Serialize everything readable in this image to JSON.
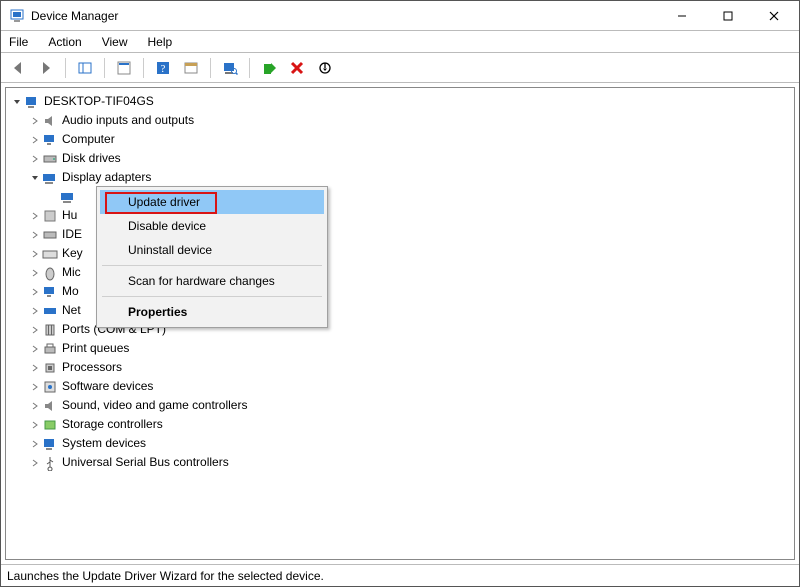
{
  "window": {
    "title": "Device Manager"
  },
  "menu": {
    "file": "File",
    "action": "Action",
    "view": "View",
    "help": "Help"
  },
  "tree": {
    "root": "DESKTOP-TIF04GS",
    "nodes": {
      "audio": "Audio inputs and outputs",
      "computer": "Computer",
      "disk": "Disk drives",
      "display": "Display adapters",
      "hid": "Hu",
      "ide": "IDE",
      "keyboards": "Key",
      "mice": "Mic",
      "monitors": "Mo",
      "network": "Net",
      "ports": "Ports (COM & LPT)",
      "printq": "Print queues",
      "proc": "Processors",
      "softdev": "Software devices",
      "svgc": "Sound, video and game controllers",
      "storage": "Storage controllers",
      "sysdev": "System devices",
      "usb": "Universal Serial Bus controllers"
    }
  },
  "context_menu": {
    "update": "Update driver",
    "disable": "Disable device",
    "uninstall": "Uninstall device",
    "scan": "Scan for hardware changes",
    "properties": "Properties"
  },
  "statusbar": {
    "text": "Launches the Update Driver Wizard for the selected device."
  }
}
